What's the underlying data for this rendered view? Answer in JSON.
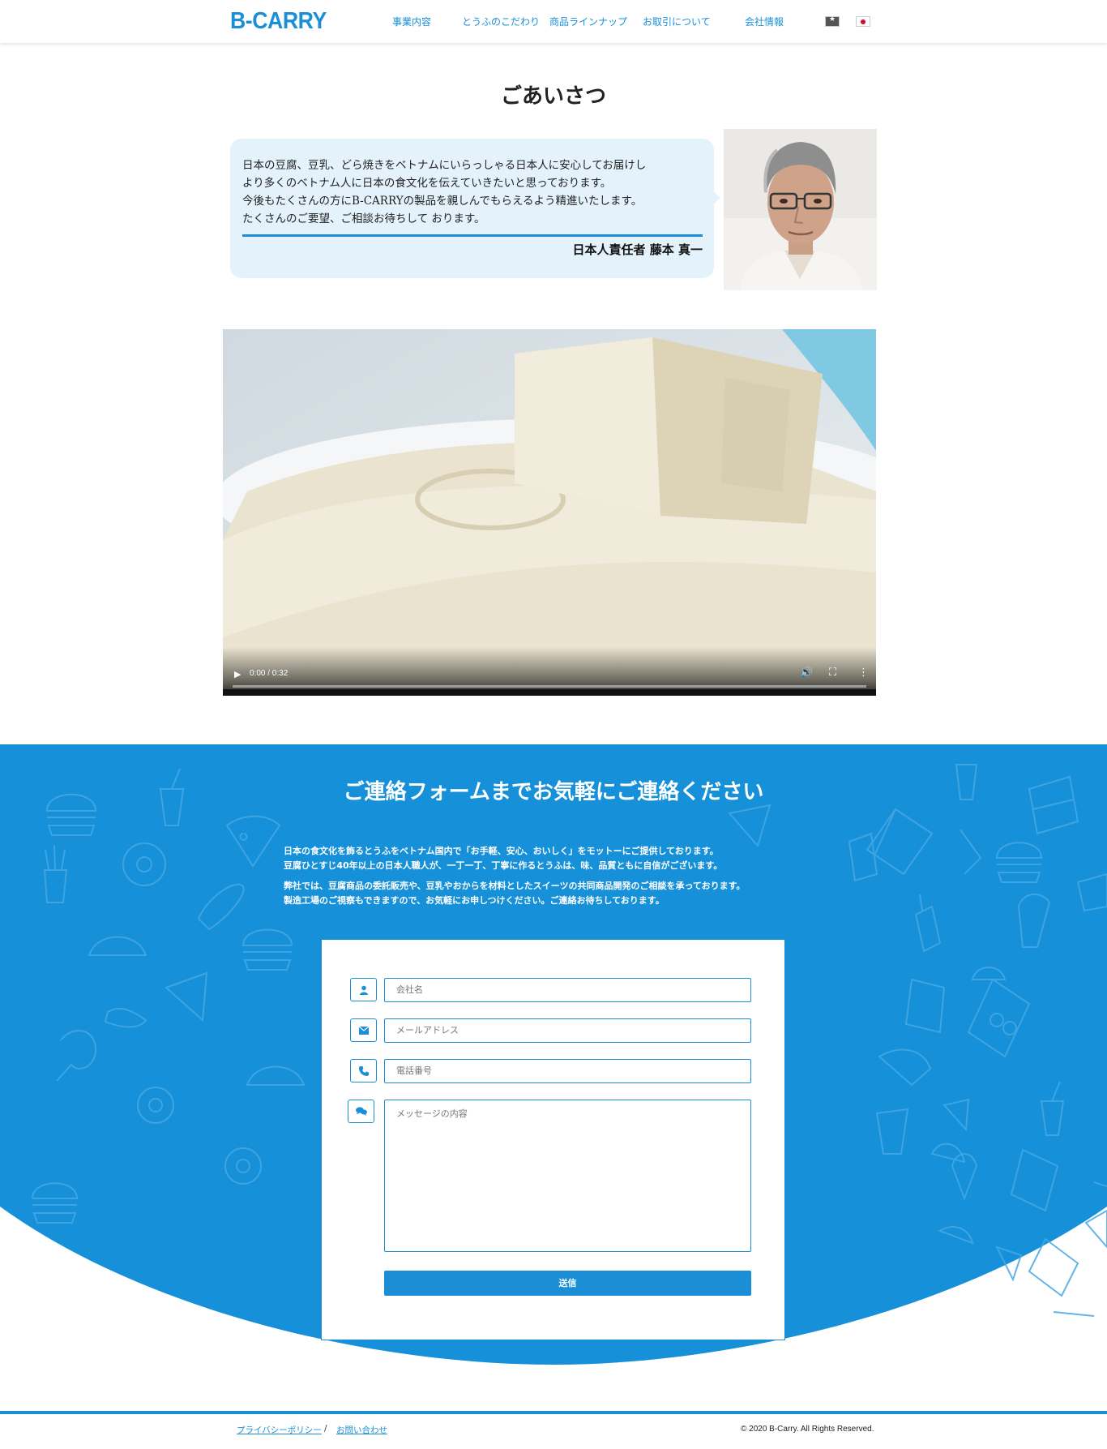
{
  "header": {
    "logo": "B-CARRY",
    "nav": [
      "事業内容",
      "とうふのこだわり",
      "商品ラインナップ",
      "お取引について",
      "会社情報"
    ]
  },
  "greeting": {
    "title": "ごあいさつ",
    "lines": [
      "日本の豆腐、豆乳、どら焼きをベトナムにいらっしゃる日本人に安心してお届けし",
      "より多くのベトナム人に日本の食文化を伝えていきたいと思っております。",
      "今後もたくさんの方にB-CARRYの製品を親しんでもらえるよう精進いたします。",
      "たくさんのご要望、ご相談お待ちして おります。"
    ],
    "signer": "日本人責任者 藤本 真一"
  },
  "video": {
    "time": "0:00 / 0:32",
    "progress": 0
  },
  "contact": {
    "title": "ご連絡フォームまでお気軽にご連絡ください",
    "paragraphs": [
      [
        "日本の食文化を飾るとうふをベトナム国内で「お手軽、安心、おいしく」をモットーにご提供しております。",
        "豆腐ひとすじ40年以上の日本人職人が、一丁一丁、丁寧に作るとうふは、味、品質ともに自信がございます。"
      ],
      [
        "弊社では、豆腐商品の委託販売や、豆乳やおからを材料としたスイーツの共同商品開発のご相談を承っております。",
        "製造工場のご視察もできますので、お気軽にお申しつけください。ご連絡お待ちしております。"
      ]
    ],
    "form": {
      "company_placeholder": "会社名",
      "email_placeholder": "メールアドレス",
      "phone_placeholder": "電話番号",
      "message_placeholder": "メッセージの内容",
      "submit_label": "送信"
    }
  },
  "footer": {
    "privacy": "プライバシーポリシー",
    "separator": "/",
    "inquiry": "お問い合わせ",
    "copyright": "© 2020 B-Carry. All Rights Reserved."
  },
  "colors": {
    "brand": "#1a8fd6",
    "bubble": "#e3f2fb"
  }
}
